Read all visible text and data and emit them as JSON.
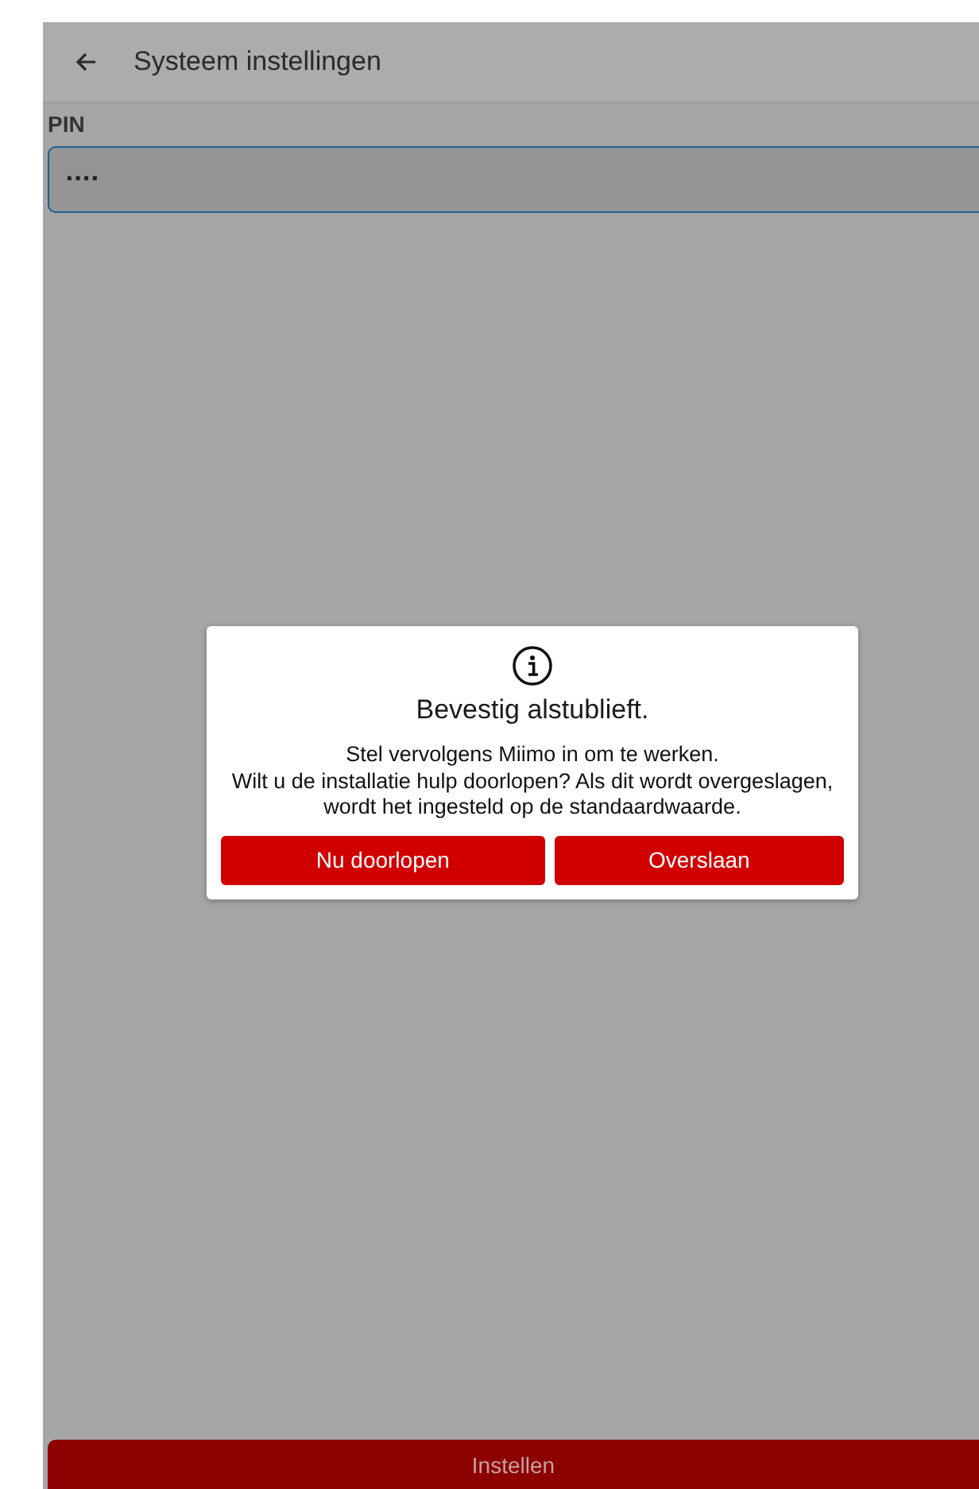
{
  "app_bar": {
    "title": "Systeem instellingen"
  },
  "pin_field": {
    "label": "PIN",
    "value": "····"
  },
  "dialog": {
    "title": "Bevestig alstublieft.",
    "message_lines": [
      "Stel vervolgens Miimo in om te werken.",
      "Wilt u de installatie hulp doorlopen? Als dit wordt overgeslagen,",
      "wordt het ingesteld op de standaardwaarde."
    ],
    "buttons": [
      "Nu doorlopen",
      "Overslaan"
    ]
  },
  "footer_button": {
    "label": "Instellen"
  }
}
